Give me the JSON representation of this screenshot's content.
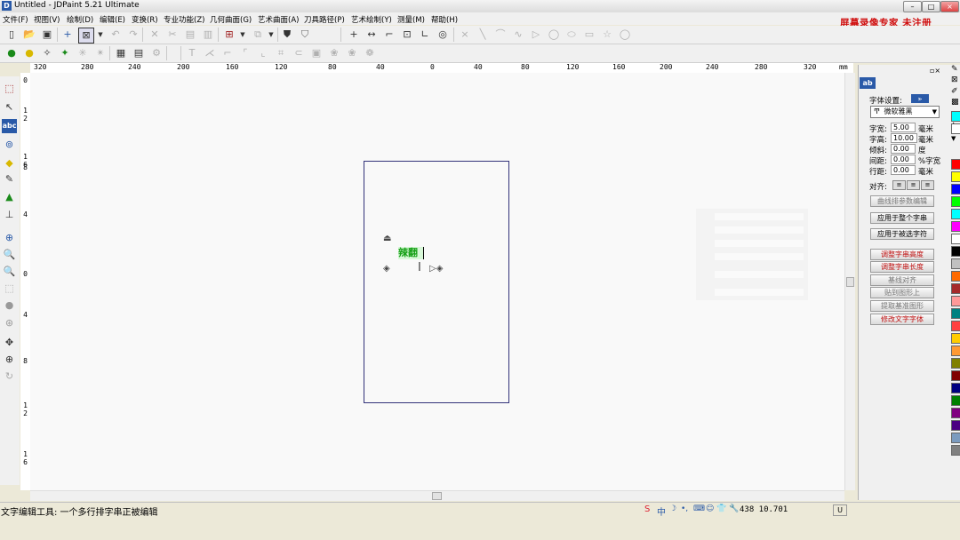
{
  "window": {
    "title": "Untitled - JDPaint 5.21 Ultimate",
    "app_icon": "D",
    "minimize_label": "–",
    "maximize_label": "□",
    "close_label": "×"
  },
  "menu": [
    "文件(F)",
    "视图(V)",
    "绘制(D)",
    "编辑(E)",
    "变换(R)",
    "专业功能(Z)",
    "几何曲面(G)",
    "艺术曲面(A)",
    "刀具路径(P)",
    "艺术绘制(Y)",
    "测量(M)",
    "帮助(H)"
  ],
  "watermark": "屏幕录像专家 未注册",
  "ruler_top": {
    "labels": [
      "320",
      "280",
      "240",
      "200",
      "160",
      "120",
      "80",
      "40",
      "0",
      "40",
      "80",
      "120",
      "160",
      "200",
      "240",
      "280",
      "320"
    ],
    "unit": "mm"
  },
  "ruler_left": {
    "labels": [
      "0",
      "1\n2",
      "1\n6",
      "8",
      "4",
      "0",
      "4",
      "8",
      "1\n2",
      "1\n6"
    ]
  },
  "text_object": {
    "content": "辣翻"
  },
  "status": {
    "message": "文字编辑工具: 一个多行排字串正被编辑",
    "coords": "438  10.701",
    "ime": "中",
    "caps": "U"
  },
  "panel": {
    "tab_label": "ab",
    "font_settings_label": "字体设置:",
    "font_settings_btn": "⪢",
    "font_name": "微软雅黑",
    "fields": [
      {
        "label": "字宽:",
        "value": "5.00",
        "unit": "毫米"
      },
      {
        "label": "字高:",
        "value": "10.00",
        "unit": "毫米"
      },
      {
        "label": "倾斜:",
        "value": "0.00",
        "unit": "度"
      },
      {
        "label": "间距:",
        "value": "0.00",
        "unit": "%字宽"
      },
      {
        "label": "行距:",
        "value": "0.00",
        "unit": "毫米"
      }
    ],
    "align_label": "对齐:",
    "buttons": [
      {
        "label": "曲线排参数编辑",
        "style": "dim"
      },
      {
        "label": "应用于整个字串",
        "style": "normal"
      },
      {
        "label": "应用于被选字符",
        "style": "normal"
      },
      {
        "label": "调整字串高度",
        "style": "red"
      },
      {
        "label": "调整字串长度",
        "style": "red"
      },
      {
        "label": "基线对齐",
        "style": "dim"
      },
      {
        "label": "贴到图形上",
        "style": "dim"
      },
      {
        "label": "提取基准图形",
        "style": "dim"
      },
      {
        "label": "修改文字字体",
        "style": "red"
      }
    ]
  },
  "palette": [
    "#00ffff",
    "#ffffff",
    "#ff0000",
    "#ffff00",
    "#0000ff",
    "#00ff00",
    "#00ffff",
    "#ff00ff",
    "#ffffff",
    "#000000",
    "#c0c0c0",
    "#ff6a00",
    "#a52a2a",
    "#ff9999",
    "#008080",
    "#ff4040",
    "#ffcc00",
    "#ff9933",
    "#808000",
    "#800000",
    "#000080",
    "#008000",
    "#800080",
    "#4b0082",
    "#7b9bbf",
    "#808080"
  ],
  "icons": {
    "main_toolbar": [
      "new-icon",
      "open-icon",
      "save-icon",
      "select-node-icon",
      "select-window-icon",
      "dropdown-icon",
      "undo-icon",
      "redo-icon",
      "cut-icon",
      "copy-icon",
      "paste-icon",
      "paste-special-icon",
      "grid-icon",
      "layer-icon",
      "dropdown-icon",
      "shield-icon",
      "shield-filled-icon",
      "cross-icon",
      "dimension-icon",
      "corner-icon",
      "frame-icon",
      "axis-icon",
      "lasso-icon",
      "point-icon",
      "line-icon",
      "arc-icon",
      "curve-icon",
      "triangle-icon",
      "circle-icon",
      "ellipse-icon",
      "rect-icon",
      "star-icon",
      "round-icon"
    ],
    "second_toolbar": [
      "lightbulb-green-icon",
      "lightbulb-yellow-icon",
      "group-icon",
      "ungroup-icon",
      "node-icon",
      "node-add-icon",
      "page-icon",
      "grid-icon",
      "settings-icon",
      "text-tool-icon",
      "trim-icon",
      "extend-icon",
      "corner-icon",
      "fillet-icon",
      "link-icon",
      "box-icon",
      "chain-icon",
      "chain2-icon"
    ],
    "left_tools": [
      "select-icon",
      "node-edit-icon",
      "text-icon",
      "node-circle-icon",
      "eraser-icon",
      "pen-icon",
      "fill-icon",
      "ruler-icon",
      "zoom-window-icon",
      "zoom-in-icon",
      "zoom-out-icon",
      "zoom-all-icon",
      "sphere-icon",
      "rotate-view-icon",
      "pan-icon",
      "zoom-icon",
      "refresh-icon"
    ]
  }
}
